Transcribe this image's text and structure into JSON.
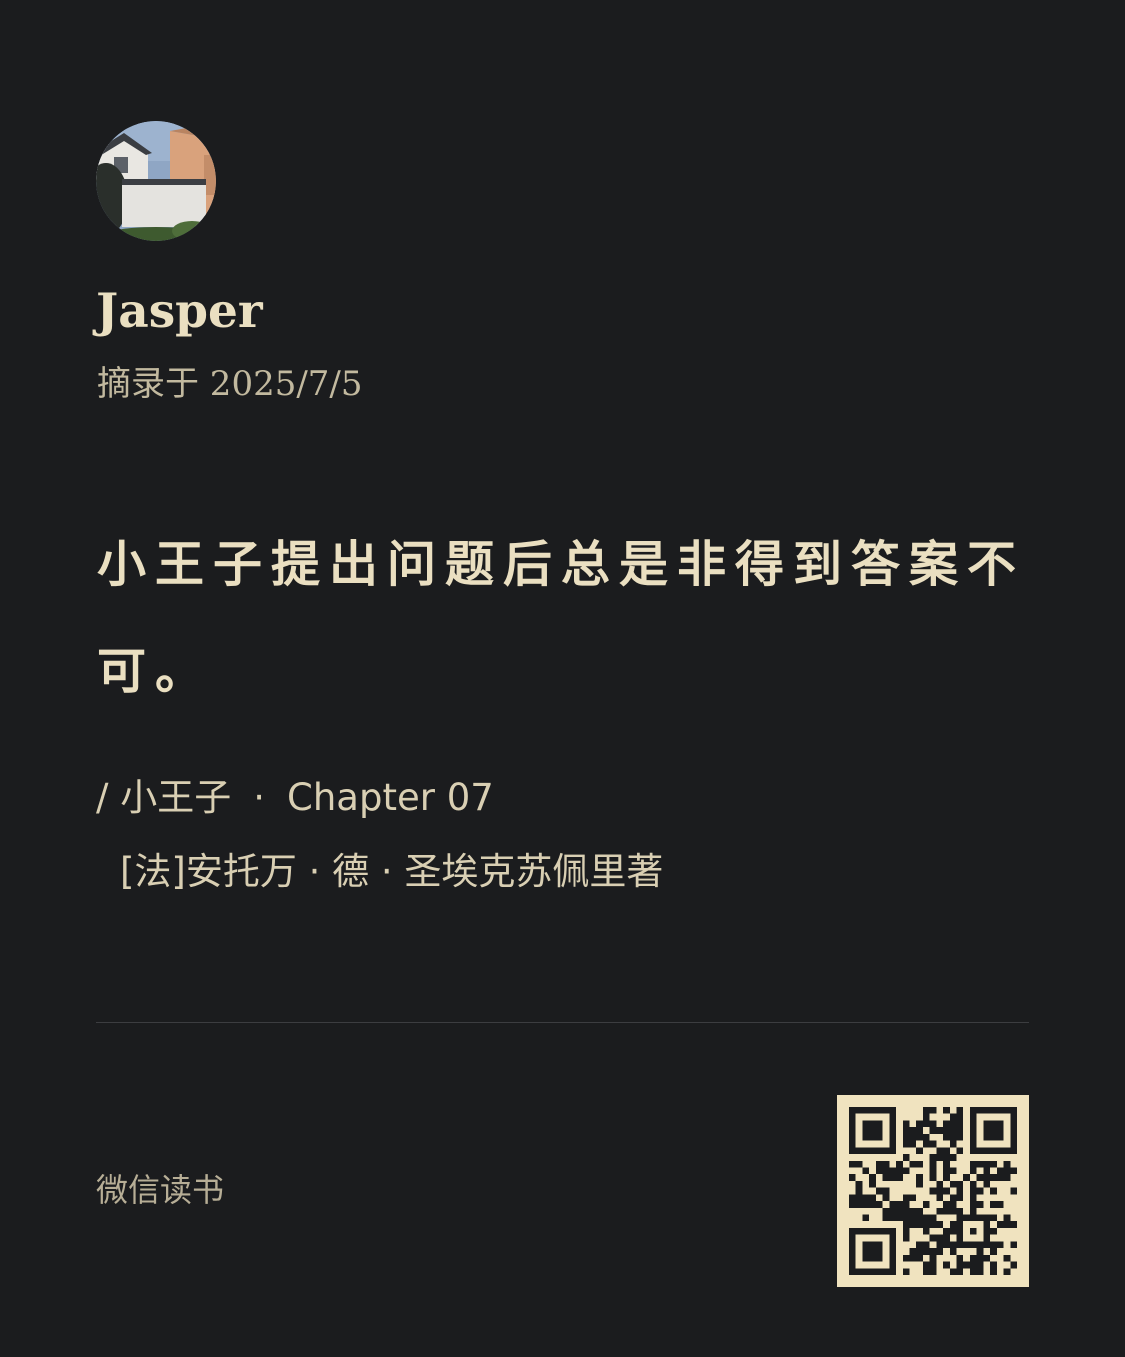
{
  "user": {
    "name": "Jasper",
    "excerpt_date": "摘录于 2025/7/5"
  },
  "quote": {
    "text": "小王子提出问题后总是非得到答案不可。"
  },
  "book": {
    "prefix": "/ 小王子",
    "separator": "·",
    "chapter": "Chapter 07",
    "author": "[法]安托万 · 德 · 圣埃克苏佩里著"
  },
  "footer": {
    "app_name": "微信读书"
  },
  "colors": {
    "background": "#1b1c1e",
    "text_primary": "#eadfc1",
    "text_secondary": "#c2b99f",
    "qr_background": "#f0e3bf",
    "divider": "#3c3d40"
  },
  "icons": {
    "avatar": "user-avatar-photo",
    "qr": "qr-code"
  }
}
